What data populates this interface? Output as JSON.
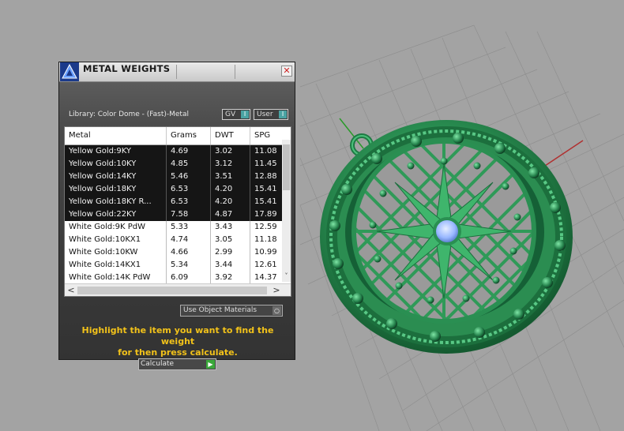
{
  "window": {
    "title": "METAL WEIGHTS",
    "close_glyph": "✕"
  },
  "library": {
    "label": "Library: Color Dome - (Fast)-Metal"
  },
  "toggles": [
    {
      "label": "GV",
      "knob_glyph": "I"
    },
    {
      "label": "User",
      "knob_glyph": "I"
    }
  ],
  "table": {
    "headers": [
      "Metal",
      "Grams",
      "DWT",
      "SPG"
    ],
    "rows": [
      {
        "metal": "Yellow Gold:9KY",
        "grams": "4.69",
        "dwt": "3.02",
        "spg": "11.08"
      },
      {
        "metal": "Yellow Gold:10KY",
        "grams": "4.85",
        "dwt": "3.12",
        "spg": "11.45"
      },
      {
        "metal": "Yellow Gold:14KY",
        "grams": "5.46",
        "dwt": "3.51",
        "spg": "12.88"
      },
      {
        "metal": "Yellow Gold:18KY",
        "grams": "6.53",
        "dwt": "4.20",
        "spg": "15.41"
      },
      {
        "metal": "Yellow Gold:18KY R...",
        "grams": "6.53",
        "dwt": "4.20",
        "spg": "15.41"
      },
      {
        "metal": "Yellow Gold:22KY",
        "grams": "7.58",
        "dwt": "4.87",
        "spg": "17.89"
      },
      {
        "metal": "White Gold:9K PdW",
        "grams": "5.33",
        "dwt": "3.43",
        "spg": "12.59"
      },
      {
        "metal": "White Gold:10KX1",
        "grams": "4.74",
        "dwt": "3.05",
        "spg": "11.18"
      },
      {
        "metal": "White Gold:10KW",
        "grams": "4.66",
        "dwt": "2.99",
        "spg": "10.99"
      },
      {
        "metal": "White Gold:14KX1",
        "grams": "5.34",
        "dwt": "3.44",
        "spg": "12.61"
      },
      {
        "metal": "White Gold:14K PdW",
        "grams": "6.09",
        "dwt": "3.92",
        "spg": "14.37"
      }
    ],
    "row_styles": [
      "dark",
      "dark",
      "dark",
      "dark",
      "dark",
      "dark",
      "light",
      "light",
      "light",
      "light",
      "light"
    ]
  },
  "scroll": {
    "down_glyph": "˅",
    "left_glyph": "<",
    "right_glyph": ">"
  },
  "use_object_materials": {
    "label": "Use Object Materials",
    "knob_glyph": "○"
  },
  "hint": {
    "line1": "Highlight the item you want to find the weight",
    "line2": "for then press calculate."
  },
  "calculate": {
    "label": "Calculate",
    "knob_glyph": "▶"
  },
  "colors": {
    "accent_teal": "#4aa3a3",
    "hint_yellow": "#f2c21a",
    "pendant_green": "#2e9a58",
    "gem_blue": "#a9c4ff"
  },
  "icons": [
    "rhino-logo-icon",
    "close-icon",
    "pendant-model"
  ]
}
